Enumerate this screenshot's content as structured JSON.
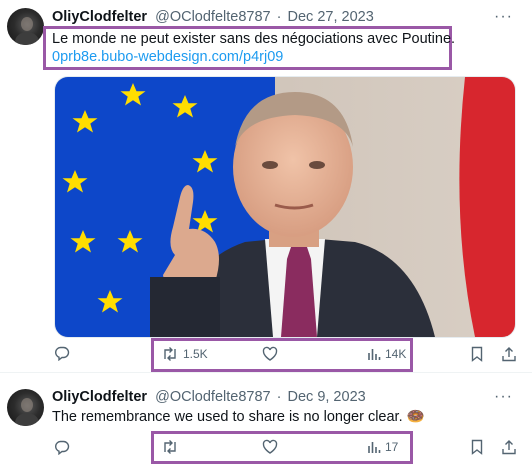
{
  "tweets": [
    {
      "author_name": "OliyClodfelter",
      "handle": "@OClodfelte8787",
      "separator": "·",
      "date": "Dec 27, 2023",
      "text": "Le monde ne peut exister sans des négociations avec Poutine.",
      "link": "0prb8e.bubo-webdesign.com/p4rj09",
      "retweets": "1.5K",
      "views": "14K",
      "more_label": "···",
      "has_media": true
    },
    {
      "author_name": "OliyClodfelter",
      "handle": "@OClodfelte8787",
      "separator": "·",
      "date": "Dec 9, 2023",
      "text": "The remembrance we used to share is no longer clear. 🍩",
      "views": "17",
      "more_label": "···"
    }
  ],
  "colors": {
    "highlight": "#9a58a6",
    "link": "#1d9bf0",
    "muted": "#536471",
    "eu_blue": "#0d47c9",
    "eu_star": "#ffdd00",
    "flag_red": "#d7262e"
  },
  "icons": [
    "reply-icon",
    "retweet-icon",
    "like-icon",
    "views-icon",
    "bookmark-icon",
    "share-icon",
    "more-icon"
  ]
}
